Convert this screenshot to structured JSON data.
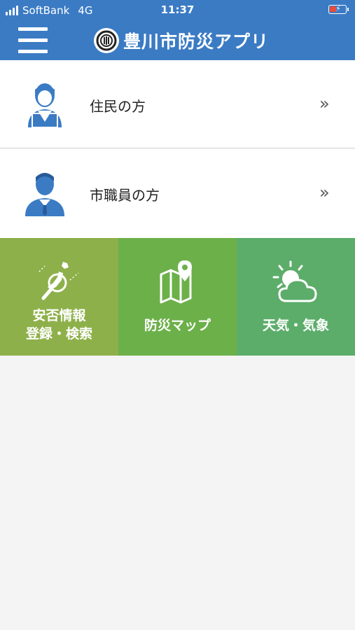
{
  "status_bar": {
    "carrier": "SoftBank",
    "network": "4G",
    "time": "11:37"
  },
  "header": {
    "title": "豊川市防災アプリ",
    "menu_icon": "hamburger-menu-icon",
    "logo_icon": "city-emblem-icon",
    "color": "#3b7bc4"
  },
  "rows": [
    {
      "label": "住民の方",
      "icon": "resident-woman-icon",
      "chevron": "»"
    },
    {
      "label": "市職員の方",
      "icon": "city-staff-man-icon",
      "chevron": "»"
    }
  ],
  "tiles": [
    {
      "line1": "安否情報",
      "line2": "登録・検索",
      "icon": "japan-map-search-icon",
      "color": "#8eb04a"
    },
    {
      "line1": "防災マップ",
      "line2": "",
      "icon": "map-pin-icon",
      "color": "#6cb04a"
    },
    {
      "line1": "天気・気象",
      "line2": "",
      "icon": "sun-cloud-icon",
      "color": "#5cad6a"
    }
  ]
}
